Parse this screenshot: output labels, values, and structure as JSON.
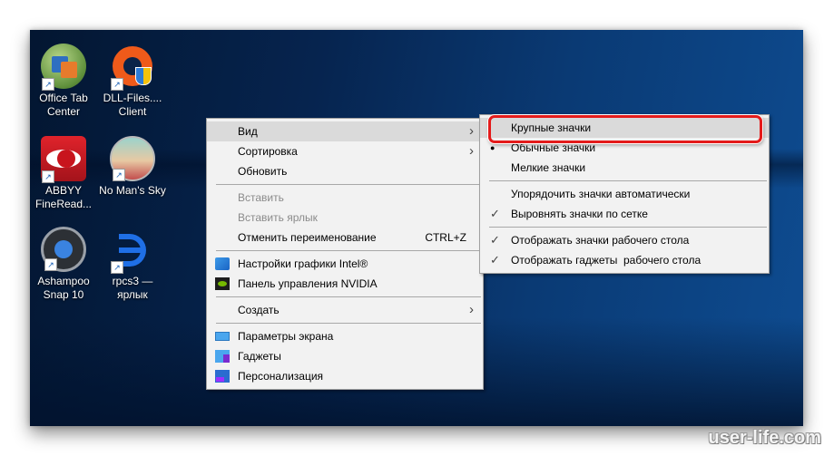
{
  "desktop_icons": [
    {
      "label_line1": "Office Tab",
      "label_line2": "Center",
      "icon": "office-tab-icon"
    },
    {
      "label_line1": "DLL-Files....",
      "label_line2": "Client",
      "icon": "dll-files-icon"
    },
    {
      "label_line1": "ABBYY",
      "label_line2": "FineRead...",
      "icon": "abbyy-icon"
    },
    {
      "label_line1": "No Man's Sky",
      "label_line2": "",
      "icon": "no-mans-sky-icon"
    },
    {
      "label_line1": "Ashampoo",
      "label_line2": "Snap 10",
      "icon": "ashampoo-icon"
    },
    {
      "label_line1": "rpcs3 —",
      "label_line2": "ярлык",
      "icon": "rpcs3-icon"
    }
  ],
  "shortcut_glyph": "↗",
  "context_menu": {
    "view": "Вид",
    "sort": "Сортировка",
    "refresh": "Обновить",
    "paste": "Вставить",
    "paste_shortcut": "Вставить ярлык",
    "undo_rename": "Отменить переименование",
    "undo_rename_key": "CTRL+Z",
    "intel": "Настройки графики Intel®",
    "nvidia": "Панель управления NVIDIA",
    "create": "Создать",
    "display": "Параметры экрана",
    "gadgets": "Гаджеты",
    "personalize": "Персонализация",
    "chevron": "›"
  },
  "view_submenu": {
    "large": "Крупные значки",
    "medium": "Обычные значки",
    "small": "Мелкие значки",
    "auto_arrange": "Упорядочить значки автоматически",
    "align_grid": "Выровнять значки по сетке",
    "show_icons": "Отображать значки рабочего стола",
    "show_gadgets": "Отображать гаджеты  рабочего стола",
    "bullet": "●",
    "check": "✓"
  },
  "watermark": "user-life.com",
  "highlight_color": "#e41b1b"
}
